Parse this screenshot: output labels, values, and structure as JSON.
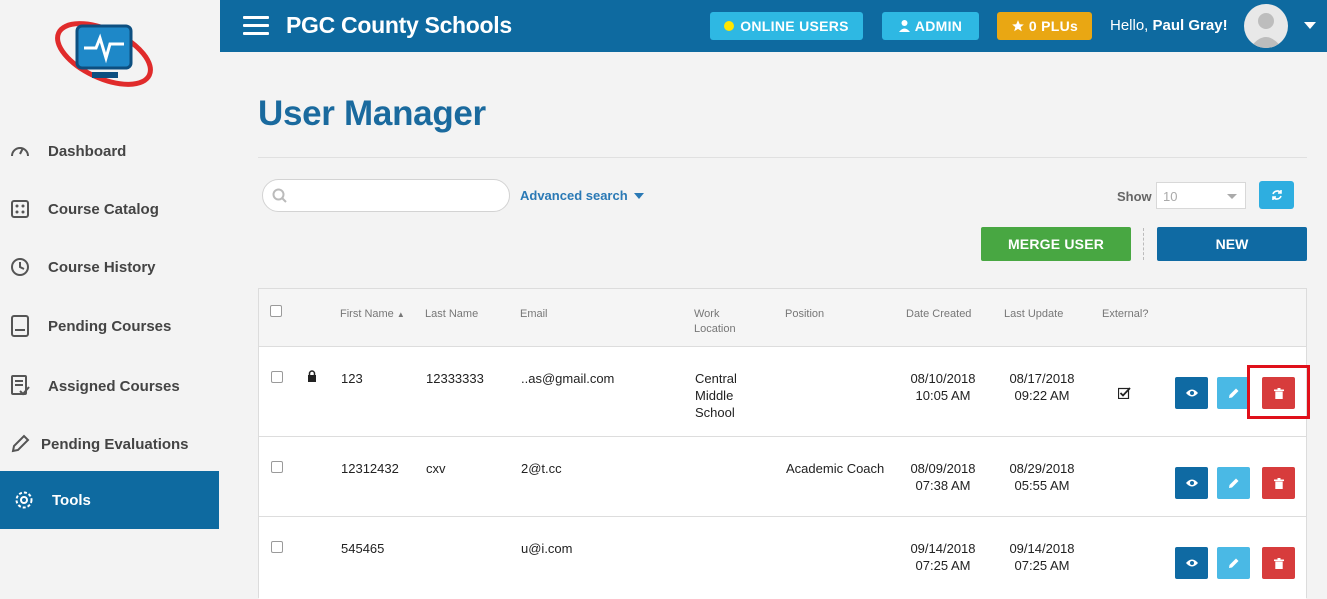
{
  "sidebar": {
    "items": [
      {
        "label": "Dashboard",
        "icon": "gauge-icon"
      },
      {
        "label": "Course Catalog",
        "icon": "catalog-icon"
      },
      {
        "label": "Course History",
        "icon": "history-icon"
      },
      {
        "label": "Pending Courses",
        "icon": "book-icon"
      },
      {
        "label": "Assigned Courses",
        "icon": "assigned-icon"
      },
      {
        "label": "Pending Evaluations",
        "icon": "pencil-icon"
      },
      {
        "label": "Tools",
        "icon": "gear-icon",
        "active": true
      }
    ]
  },
  "header": {
    "title": "PGC County Schools",
    "online_users": "ONLINE USERS",
    "admin": "ADMIN",
    "plus": "0 PLUs",
    "greeting": "Hello,",
    "user_name": "Paul Gray!"
  },
  "main": {
    "title": "User Manager",
    "search_placeholder": "",
    "advanced_search": "Advanced search",
    "show_label": "Show",
    "show_value": "10",
    "merge_label": "MERGE USER",
    "new_label": "NEW"
  },
  "table": {
    "columns": [
      "First Name",
      "Last Name",
      "Email",
      "Work Location",
      "Position",
      "Date Created",
      "Last Update",
      "External?"
    ],
    "rows": [
      {
        "first": "123",
        "last": "12333333",
        "email": "..as@gmail.com",
        "location": "Central Middle School",
        "position": "",
        "created_date": "08/10/2018",
        "created_time": "10:05 AM",
        "updated_date": "08/17/2018",
        "updated_time": "09:22 AM",
        "external": true,
        "locked": true
      },
      {
        "first": "12312432",
        "last": "cxv",
        "email": "2@t.cc",
        "location": "",
        "position": "Academic Coach",
        "created_date": "08/09/2018",
        "created_time": "07:38 AM",
        "updated_date": "08/29/2018",
        "updated_time": "05:55 AM",
        "external": false,
        "locked": false
      },
      {
        "first": "545465",
        "last": "",
        "email": "u@i.com",
        "location": "",
        "position": "",
        "created_date": "09/14/2018",
        "created_time": "07:25 AM",
        "updated_date": "09/14/2018",
        "updated_time": "07:25 AM",
        "external": false,
        "locked": false
      }
    ]
  },
  "colors": {
    "brand": "#0e6aa0",
    "online": "#2eb8e3",
    "plus": "#e9a713",
    "merge": "#48a742",
    "delete": "#d73c3c",
    "highlight": "#e0101a"
  }
}
